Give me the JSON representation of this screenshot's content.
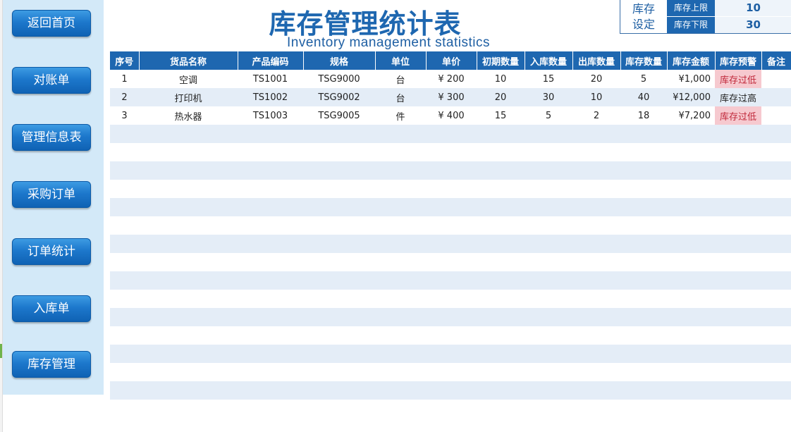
{
  "title": "库存管理统计表",
  "subtitle": "Inventory management statistics",
  "nav": [
    "返回首页",
    "对账单",
    "管理信息表",
    "采购订单",
    "订单统计",
    "入库单",
    "库存管理"
  ],
  "settings": {
    "label_line1": "库存",
    "label_line2": "设定",
    "upper_label": "库存上限",
    "upper_value": "10",
    "lower_label": "库存下限",
    "lower_value": "30"
  },
  "table": {
    "headers": [
      "序号",
      "货品名称",
      "产品编码",
      "规格",
      "单位",
      "单价",
      "初期数量",
      "入库数量",
      "出库数量",
      "库存数量",
      "库存金额",
      "库存预警",
      "备注"
    ],
    "rows": [
      [
        "1",
        "空调",
        "TS1001",
        "TSG9000",
        "台",
        "¥ 200",
        "10",
        "15",
        "20",
        "5",
        "¥1,000",
        "库存过低",
        ""
      ],
      [
        "2",
        "打印机",
        "TS1002",
        "TSG9002",
        "台",
        "¥ 300",
        "20",
        "30",
        "10",
        "40",
        "¥12,000",
        "库存过高",
        ""
      ],
      [
        "3",
        "热水器",
        "TS1003",
        "TSG9005",
        "件",
        "¥ 400",
        "15",
        "5",
        "2",
        "18",
        "¥7,200",
        "库存过低",
        ""
      ]
    ],
    "alert_low_text": "库存过低",
    "empty_rows": 15
  },
  "colors": {
    "accent": "#1e67b0",
    "sidebar_bg": "#d3e9f8",
    "stripe": "#e4edf7",
    "alert_low_bg": "#f6c9cf",
    "alert_low_text": "#c0283a"
  }
}
